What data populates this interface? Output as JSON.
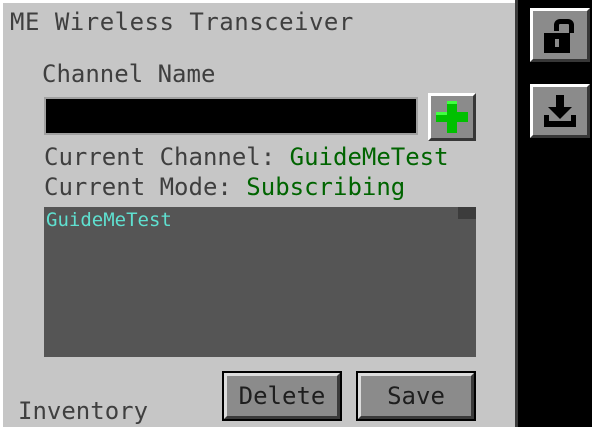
{
  "window": {
    "title": "ME Wireless Transceiver"
  },
  "channel_name": {
    "label": "Channel Name",
    "value": "",
    "placeholder": ""
  },
  "add_button": {
    "icon": "plus-icon",
    "color": "#00c000"
  },
  "status": {
    "channel_label": "Current Channel: ",
    "channel_value": "GuideMeTest",
    "mode_label": "Current Mode: ",
    "mode_value": "Subscribing"
  },
  "channel_list": {
    "items": [
      "GuideMeTest"
    ],
    "item_color": "#5fe0d0"
  },
  "buttons": {
    "delete_label": "Delete",
    "save_label": "Save"
  },
  "inventory": {
    "label": "Inventory"
  },
  "side_tabs": [
    {
      "icon": "unlock-icon"
    },
    {
      "icon": "download-icon"
    }
  ],
  "colors": {
    "panel": "#c6c6c6",
    "value_green": "#006400",
    "list_bg": "#555555"
  }
}
